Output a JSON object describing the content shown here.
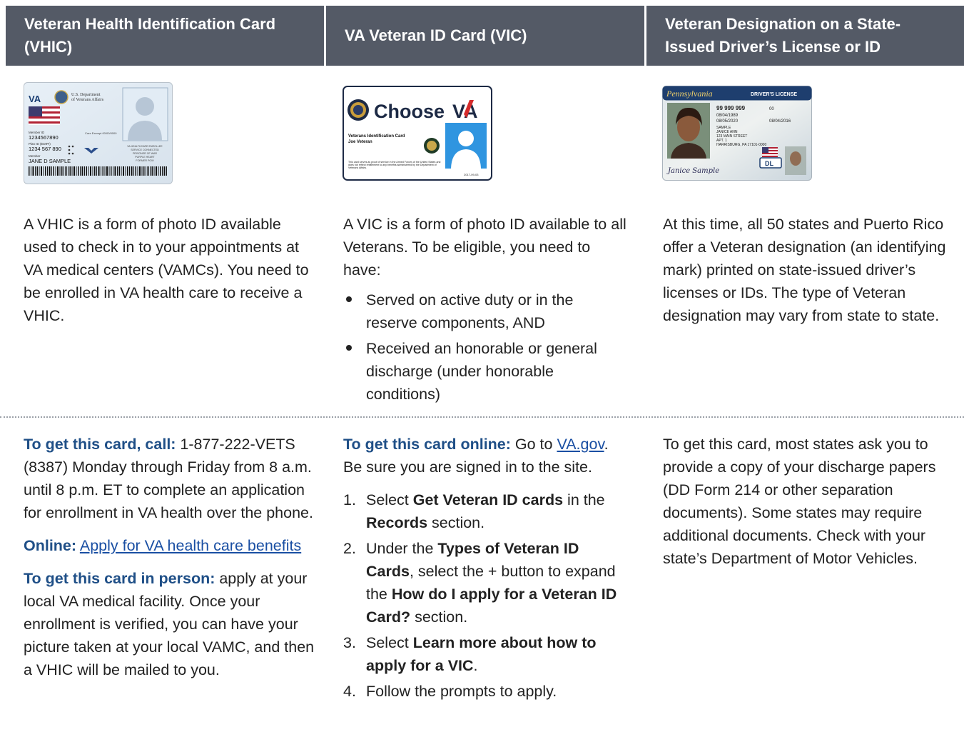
{
  "headers": {
    "vhic": "Veteran Health Identification Card (VHIC)",
    "vic": "VA Veteran ID Card (VIC)",
    "state": "Veteran Designation on a State-Issued Driver’s License or ID"
  },
  "vhic_card": {
    "va": "VA",
    "dept_line1": "U.S. Department",
    "dept_line2": "of Veterans Affairs",
    "member_label": "Member ID",
    "member_id": "1234567890",
    "plan_label": "Plan ID (EDIPI)",
    "plan_id": "1234 567 890",
    "name_label": "Member",
    "name": "JANE D SAMPLE",
    "copay": "Care Exempt 00/00/0000",
    "status_1": "VA HEALTHCARE ENROLLEE",
    "status_2": "SERVICE CONNECTED",
    "status_3": "PRISONER OF WAR",
    "status_4": "PURPLE HEART",
    "status_5": "FORMER POW"
  },
  "vic_card": {
    "brand": "Choose",
    "brand_va": "VA",
    "title": "Veterans Identification Card",
    "name": "Joe Veteran",
    "fine_print": "This card serves as proof of service in the Armed Forces of the United States and does not reflect entitlement to any benefits administered by the Department of Veterans Affairs.",
    "date": "2017-09-03"
  },
  "dl_card": {
    "state": "Pennsylvania",
    "label": "DRIVER'S LICENSE",
    "num": "99 999 999",
    "dob": "08/04/1989",
    "exp": "08/05/2020",
    "iss": "08/04/2016",
    "name1": "SAMPLE",
    "name2": "JANICE ANN",
    "addr1": "123 MAIN STREET",
    "addr2": "APT. 1",
    "addr3": "HARRISBURG, PA 17101-0000",
    "dups": "00",
    "dl": "DL",
    "signature": "Janice Sample"
  },
  "vhic_text": "A VHIC is a form of photo ID available used to check in to your appointments at VA medical centers (VAMCs). You need to be enrolled in VA health care to receive a VHIC.",
  "vic_text": {
    "intro": "A VIC is a form of photo ID available to all Veterans. To be eligible, you need to have:",
    "bullets": [
      "Served on active duty or in the reserve components, AND",
      "Received an honorable or general discharge (under honorable conditions)"
    ]
  },
  "state_text": "At this time, all 50 states and Puerto Rico offer a Veteran designation (an identifying mark) printed on state-issued driver’s licenses or IDs. The type of Veteran designation may vary from state to state.",
  "vhic_get": {
    "call_lead": "To get this card, call:",
    "call_text": " 1-877-222-VETS (8387) Monday through Friday from 8 a.m. until 8 p.m. ET to complete an application for enrollment in VA health over the phone.",
    "online_lead": "Online:",
    "online_link": "Apply for VA health care benefits",
    "person_lead": "To get this card in person:",
    "person_text": " apply at your local VA medical facility. Once your enrollment is verified, you can have your picture taken at your local VAMC, and then a VHIC will be mailed to you."
  },
  "vic_get": {
    "lead": "To get this card online:",
    "go_to": " Go to ",
    "link": "VA.gov",
    "after": ". Be sure you are signed in to the site.",
    "steps": {
      "n1": "1.",
      "s1_a": "Select ",
      "s1_b": "Get Veteran ID cards",
      "s1_c": " in the ",
      "s1_d": "Records",
      "s1_e": " section.",
      "n2": "2.",
      "s2_a": "Under the ",
      "s2_b": "Types of Veteran ID Cards",
      "s2_c": ", select the + button to expand the ",
      "s2_d": "How do I apply for a Veteran ID Card?",
      "s2_e": " section.",
      "n3": "3.",
      "s3_a": "Select ",
      "s3_b": "Learn more about how to apply for a VIC",
      "s3_c": ".",
      "n4": "4.",
      "s4_a": "Follow the prompts to apply."
    }
  },
  "state_get": "To get this card, most states ask you to provide a copy of your discharge papers (DD Form 214 or other separation documents). Some states may require additional documents. Check with your state’s Department of Motor Vehicles."
}
